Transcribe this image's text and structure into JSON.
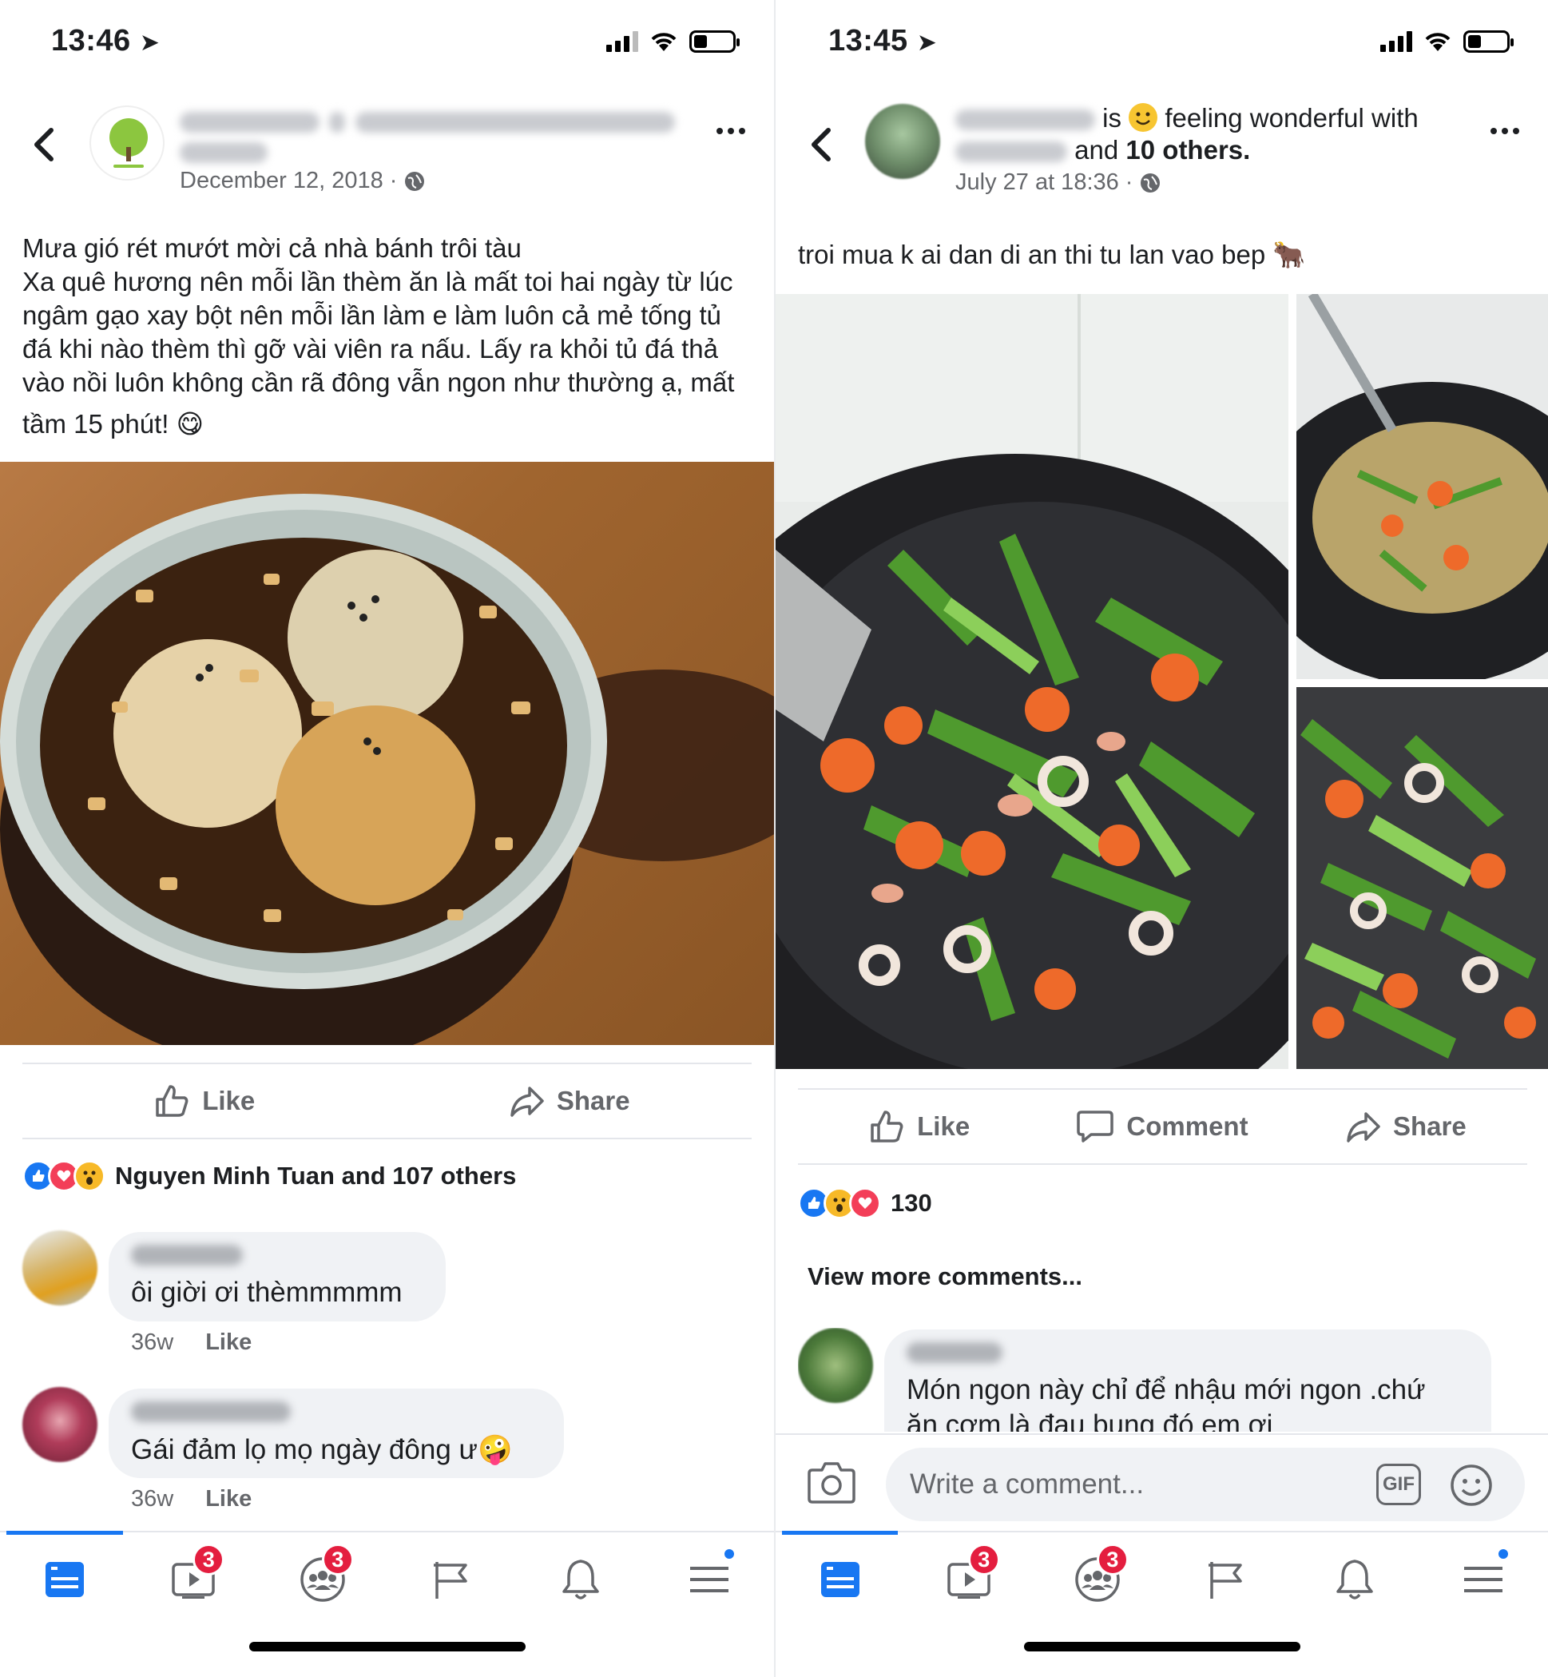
{
  "left": {
    "status": {
      "time": "13:46"
    },
    "post": {
      "date": "December 12, 2018",
      "text_lines": [
        "Mưa gió rét mướt mời cả nhà bánh trôi tàu",
        "Xa quê hương nên mỗi lần thèm ăn là mất toi hai ngày từ lúc",
        "ngâm gạo xay bột nên mỗi lần làm e làm luôn cả mẻ tống tủ",
        "đá khi nào thèm thì gỡ vài viên ra nấu. Lấy ra khỏi tủ đá thả",
        "vào nồi luôn không cần rã đông vẫn ngon như thường ạ, mất",
        "tầm 15 phút! 😋"
      ]
    },
    "actions": {
      "like": "Like",
      "share": "Share"
    },
    "reactions_summary": "Nguyen Minh Tuan and 107 others",
    "comments": [
      {
        "text": "ôi giời ơi thèmmmmm",
        "time": "36w",
        "like": "Like"
      },
      {
        "text": "Gái đảm lọ mọ ngày đông ư🤪",
        "time": "36w",
        "like": "Like"
      }
    ],
    "nav": {
      "watch_badge": "3",
      "groups_badge": "3"
    }
  },
  "right": {
    "status": {
      "time": "13:45"
    },
    "post": {
      "header_is": "is",
      "feeling": "feeling wonderful with",
      "and_text": "and",
      "others": "10 others.",
      "date": "July 27 at 18:36",
      "text": "troi mua k ai dan di an thi tu lan vao bep 🐂"
    },
    "actions": {
      "like": "Like",
      "comment": "Comment",
      "share": "Share"
    },
    "reaction_count": "130",
    "view_more": "View more comments...",
    "comments": [
      {
        "text_line1": "Món ngon này chỉ để nhậu mới ngon .chứ",
        "text_line2": "ăn cơm là đau bụng đó em ơi"
      }
    ],
    "composer": {
      "placeholder": "Write a comment...",
      "gif": "GIF"
    },
    "nav": {
      "watch_badge": "3",
      "groups_badge": "3"
    }
  },
  "icons": [
    "back-chevron-icon",
    "globe-icon",
    "more-icon",
    "like-icon",
    "comment-icon",
    "share-icon",
    "camera-icon",
    "gif-icon",
    "emoji-icon",
    "news-feed-icon",
    "watch-icon",
    "groups-icon",
    "pages-flag-icon",
    "bell-icon",
    "menu-icon"
  ],
  "colors": {
    "brand": "#1877f2",
    "badge": "#e41e3f",
    "text": "#1c1e21",
    "secondary": "#65676b"
  }
}
